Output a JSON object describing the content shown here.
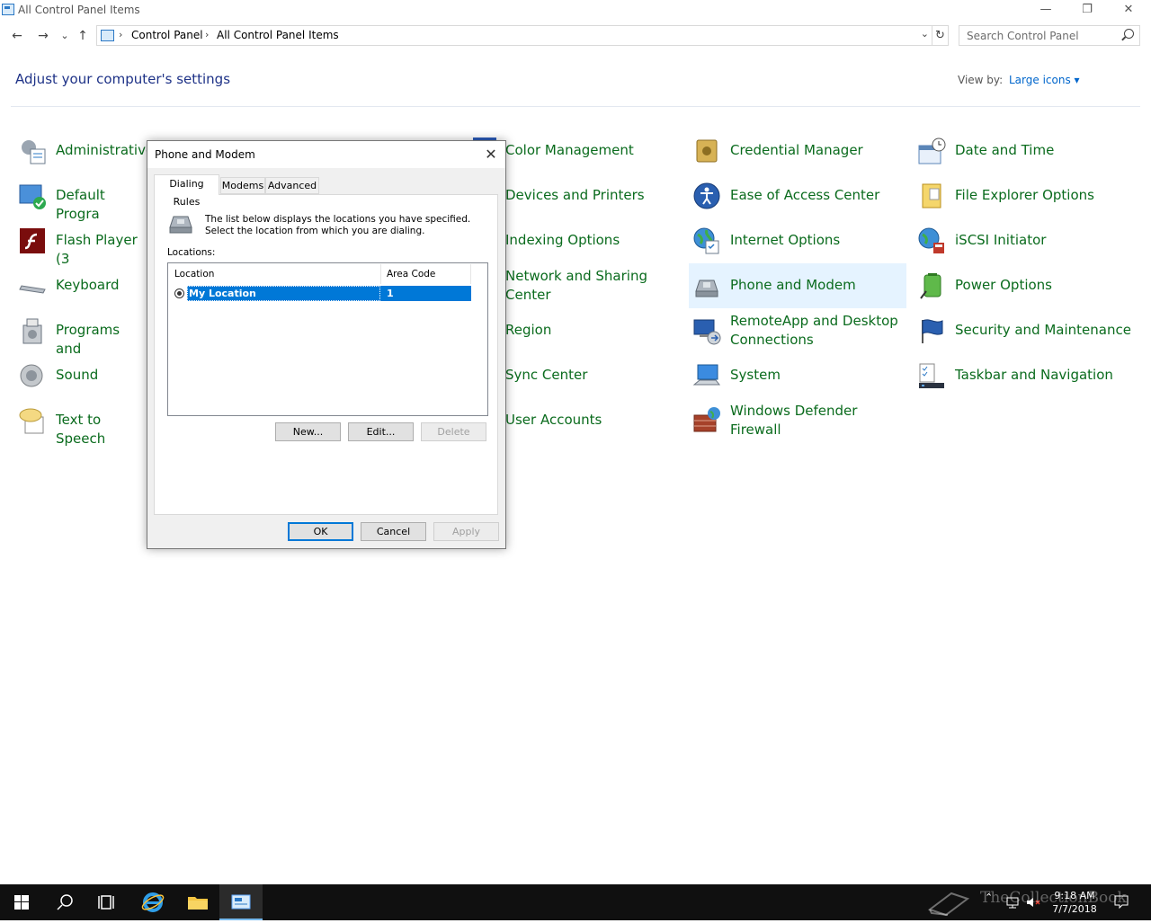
{
  "window": {
    "title": "All Control Panel Items",
    "minimize": "—",
    "restore": "❐",
    "close": "✕"
  },
  "address": {
    "back": "←",
    "forward": "→",
    "recent": "⌄",
    "up": "↑",
    "crumb_sep": "›",
    "crumbs": [
      "Control Panel",
      "All Control Panel Items"
    ],
    "refresh": "↻",
    "search_placeholder": "Search Control Panel"
  },
  "header": {
    "title": "Adjust your computer's settings",
    "view_by_label": "View by:",
    "view_by_value": "Large icons ▾"
  },
  "items": {
    "col1": [
      "Administrative",
      "Default Progra",
      "Flash Player (3",
      "Keyboard",
      "Programs and",
      "Sound",
      "Text to Speech"
    ],
    "col3": [
      "Color Management",
      "Devices and Printers",
      "Indexing Options",
      "Network and Sharing Center",
      "Region",
      "Sync Center",
      "User Accounts"
    ],
    "col4": [
      "Credential Manager",
      "Ease of Access Center",
      "Internet Options",
      "Phone and Modem",
      "RemoteApp and Desktop Connections",
      "System",
      "Windows Defender Firewall"
    ],
    "col5": [
      "Date and Time",
      "File Explorer Options",
      "iSCSI Initiator",
      "Power Options",
      "Security and Maintenance",
      "Taskbar and Navigation"
    ]
  },
  "dialog": {
    "title": "Phone and Modem",
    "close": "✕",
    "tabs": [
      "Dialing Rules",
      "Modems",
      "Advanced"
    ],
    "description": "The list below displays the locations you have specified. Select the location from which you are dialing.",
    "locations_label": "Locations:",
    "columns": [
      "Location",
      "Area Code"
    ],
    "rows": [
      {
        "location": "My Location",
        "area_code": "1"
      }
    ],
    "buttons": {
      "new": "New...",
      "edit": "Edit...",
      "delete": "Delete",
      "ok": "OK",
      "cancel": "Cancel",
      "apply": "Apply"
    }
  },
  "taskbar": {
    "time": "9:18 AM",
    "date": "7/7/2018",
    "watermark": "TheCollectionBook"
  },
  "colors": {
    "link_green": "#0a6b1d",
    "heading_blue": "#1e3287",
    "selection_blue": "#0078d7",
    "highlight": "#e5f3ff"
  }
}
